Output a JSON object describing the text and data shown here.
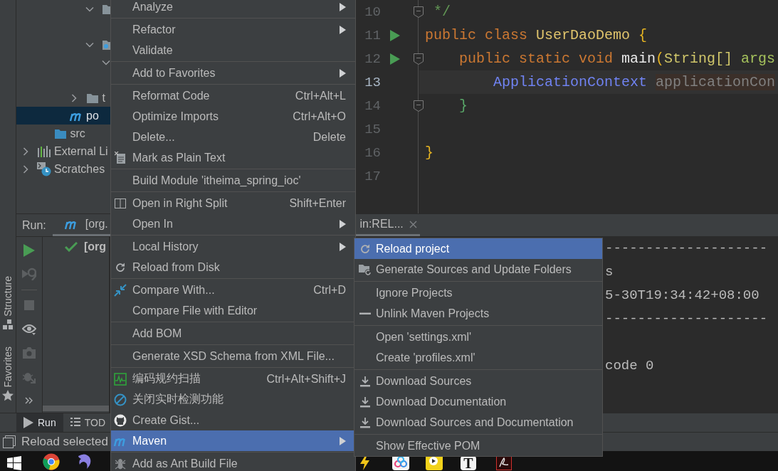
{
  "project_tree": [
    {
      "kind": "ancestor",
      "children": [
        {
          "kind": "ancestor",
          "children": [
            {
              "kind": "ancestor",
              "children": [
                {
                  "kind": "ancestor",
                  "children": [
                    {
                      "kind": "folder",
                      "expanded": true,
                      "children": [
                        {
                          "kind": "blank"
                        }
                      ]
                    },
                    {
                      "kind": "module",
                      "expanded": true,
                      "children": [
                        {
                          "kind": "covered",
                          "expanded": true,
                          "children": [
                            {
                              "kind": "blank"
                            }
                          ]
                        }
                      ]
                    }
                  ]
                },
                {
                  "kind": "folder",
                  "label": "t",
                  "expanded": false,
                  "selected": false
                }
              ]
            },
            {
              "kind": "maven_file",
              "label": "po",
              "selected": true
            }
          ]
        },
        {
          "kind": "source_folder",
          "label": "src",
          "selected": false
        }
      ]
    },
    {
      "kind": "library",
      "label": "External Li",
      "expanded": false,
      "selected": false
    },
    {
      "kind": "scratches",
      "label": "Scratches",
      "expanded": false,
      "selected": false
    }
  ],
  "editor": {
    "lines": [
      {
        "number": "10",
        "current": false,
        "runnable": false,
        "foldable": true,
        "tokens": [
          {
            "text": " */",
            "kind": "comment"
          }
        ]
      },
      {
        "number": "11",
        "current": false,
        "runnable": true,
        "foldable": false,
        "tokens": [
          {
            "text": "public class ",
            "kind": "keyword"
          },
          {
            "text": "UserDaoDemo ",
            "kind": "class"
          },
          {
            "text": "{",
            "kind": "bracket_outer"
          }
        ]
      },
      {
        "number": "12",
        "current": false,
        "runnable": true,
        "foldable": true,
        "tokens": [
          {
            "text": "    public static void ",
            "kind": "keyword"
          },
          {
            "text": "main",
            "kind": "method"
          },
          {
            "text": "(",
            "kind": "bracket_outer"
          },
          {
            "text": "String[] ",
            "kind": "type"
          },
          {
            "text": "args",
            "kind": "param"
          }
        ]
      },
      {
        "number": "13",
        "current": true,
        "runnable": false,
        "foldable": false,
        "tokens": [
          {
            "text": "        ApplicationContext ",
            "kind": "interface"
          },
          {
            "text": "applicationCon",
            "kind": "unused"
          }
        ]
      },
      {
        "number": "14",
        "current": false,
        "runnable": false,
        "foldable": true,
        "tokens": [
          {
            "text": "    }",
            "kind": "bracket_inner"
          }
        ]
      },
      {
        "number": "15",
        "current": false,
        "runnable": false,
        "foldable": false
      },
      {
        "number": "16",
        "current": false,
        "runnable": false,
        "foldable": false,
        "tokens": [
          {
            "text": "}",
            "kind": "bracket_outer"
          }
        ]
      },
      {
        "number": "17",
        "current": false,
        "runnable": false,
        "foldable": false
      }
    ]
  },
  "run_panel": {
    "label": "Run:",
    "tab": {
      "label": "[org.",
      "tail": "in:REL...",
      "selected": true
    },
    "tree": [
      {
        "label": "[org",
        "passed": true
      }
    ],
    "console": [
      [
        "--------------------",
        "s",
        "5-30T19:34:42+08:00",
        "--------------------"
      ],
      [
        "code 0"
      ]
    ]
  },
  "side_tabs": [
    {
      "label": "Structure"
    },
    {
      "label": "Favorites"
    }
  ],
  "tool_window_bar": [
    {
      "label": "Run",
      "selected": true
    },
    {
      "label": "TOD",
      "selected": false
    }
  ],
  "status_bar": {
    "text": "Reload selected"
  },
  "taskbar": {
    "app_letter": "T"
  },
  "context_menu": {
    "groups": [
      [
        {
          "label": "Analyze",
          "has_submenu": true,
          "selected": false
        }
      ],
      [
        {
          "label": "Refactor",
          "has_submenu": true,
          "selected": false
        },
        {
          "label": "Validate",
          "has_submenu": false,
          "selected": false
        }
      ],
      [
        {
          "label": "Add to Favorites",
          "has_submenu": true,
          "selected": false
        }
      ],
      [
        {
          "label": "Reformat Code",
          "shortcut": "Ctrl+Alt+L",
          "has_submenu": false,
          "selected": false
        },
        {
          "label": "Optimize Imports",
          "shortcut": "Ctrl+Alt+O",
          "has_submenu": false,
          "selected": false
        },
        {
          "label": "Delete...",
          "shortcut": "Delete",
          "has_submenu": false,
          "selected": false
        },
        {
          "label": "Mark as Plain Text",
          "has_submenu": false,
          "selected": false
        }
      ],
      [
        {
          "label": "Build Module 'itheima_spring_ioc'",
          "has_submenu": false,
          "selected": false
        }
      ],
      [
        {
          "label": "Open in Right Split",
          "shortcut": "Shift+Enter",
          "has_submenu": false,
          "selected": false
        },
        {
          "label": "Open In",
          "has_submenu": true,
          "selected": false
        }
      ],
      [
        {
          "label": "Local History",
          "has_submenu": true,
          "selected": false
        },
        {
          "label": "Reload from Disk",
          "has_submenu": false,
          "selected": false
        }
      ],
      [
        {
          "label": "Compare With...",
          "shortcut": "Ctrl+D",
          "has_submenu": false,
          "selected": false
        },
        {
          "label": "Compare File with Editor",
          "has_submenu": false,
          "selected": false
        }
      ],
      [
        {
          "label": "Add BOM",
          "has_submenu": false,
          "selected": false
        }
      ],
      [
        {
          "label": "Generate XSD Schema from XML File...",
          "has_submenu": false,
          "selected": false
        }
      ],
      [
        {
          "label": "编码规约扫描",
          "shortcut": "Ctrl+Alt+Shift+J",
          "has_submenu": false,
          "selected": false
        },
        {
          "label": "关闭实时检测功能",
          "has_submenu": false,
          "selected": false
        },
        {
          "label": "Create Gist...",
          "has_submenu": false,
          "selected": false
        },
        {
          "label": "Maven",
          "has_submenu": true,
          "selected": true
        }
      ],
      [
        {
          "label": "Add as Ant Build File",
          "has_submenu": false,
          "selected": false
        }
      ]
    ]
  },
  "submenu": {
    "groups": [
      [
        {
          "label": "Reload project",
          "selected": true
        },
        {
          "label": "Generate Sources and Update Folders",
          "selected": false
        }
      ],
      [
        {
          "label": "Ignore Projects",
          "selected": false
        },
        {
          "label": "Unlink Maven Projects",
          "selected": false
        }
      ],
      [
        {
          "label": "Open 'settings.xml'",
          "selected": false
        },
        {
          "label": "Create 'profiles.xml'",
          "selected": false
        }
      ],
      [
        {
          "label": "Download Sources",
          "selected": false
        },
        {
          "label": "Download Documentation",
          "selected": false
        },
        {
          "label": "Download Sources and Documentation",
          "selected": false
        }
      ],
      [
        {
          "label": "Show Effective POM",
          "selected": false
        }
      ]
    ]
  }
}
